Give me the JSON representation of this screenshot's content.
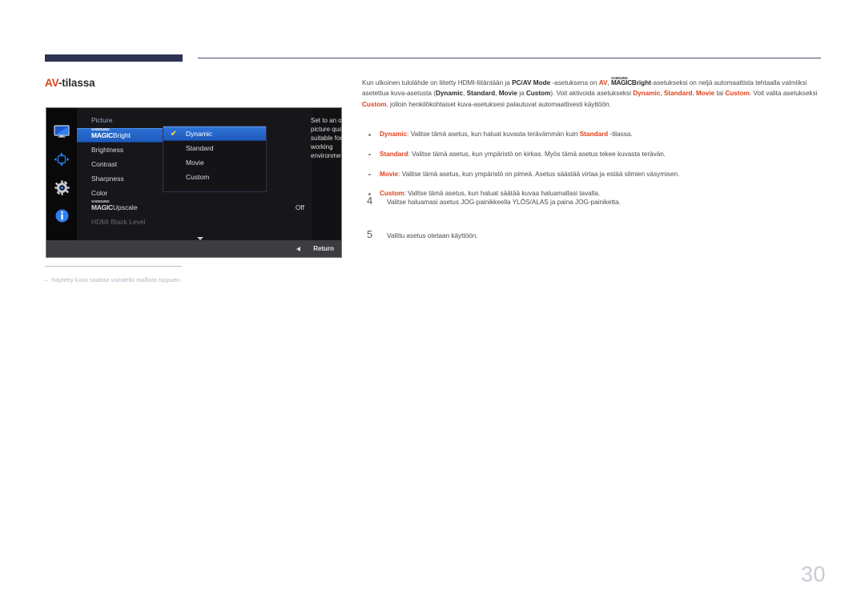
{
  "heading": {
    "accent": "AV",
    "rest": "-tilassa"
  },
  "osd": {
    "title": "Picture",
    "rail_icons": [
      "monitor-icon",
      "joystick-icon",
      "gear-icon",
      "info-icon"
    ],
    "menu_items": [
      {
        "label_small": "SAMSUNG",
        "label_main": "MAGIC",
        "label_tail": "Bright",
        "value": "",
        "selected": true,
        "dim": false
      },
      {
        "label_main": "",
        "label_tail": "Brightness",
        "value": "",
        "selected": false,
        "dim": false
      },
      {
        "label_main": "",
        "label_tail": "Contrast",
        "value": "",
        "selected": false,
        "dim": false
      },
      {
        "label_main": "",
        "label_tail": "Sharpness",
        "value": "",
        "selected": false,
        "dim": false
      },
      {
        "label_main": "",
        "label_tail": "Color",
        "value": "",
        "selected": false,
        "dim": false
      },
      {
        "label_small": "SAMSUNG",
        "label_main": "MAGIC",
        "label_tail": "Upscale",
        "value": "Off",
        "selected": false,
        "dim": false
      },
      {
        "label_main": "",
        "label_tail": "HDMI Black Level",
        "value": "",
        "selected": false,
        "dim": true
      }
    ],
    "submenu": [
      {
        "label": "Dynamic",
        "checked": true,
        "selected": true
      },
      {
        "label": "Standard",
        "checked": false,
        "selected": false
      },
      {
        "label": "Movie",
        "checked": false,
        "selected": false
      },
      {
        "label": "Custom",
        "checked": false,
        "selected": false
      }
    ],
    "help_text": "Set to an optimum picture quality suitable for the working environment.",
    "return_label": "Return"
  },
  "footnote": {
    "dash": "‒",
    "text": "Näytetty kuva saattaa vaihdella mallista riippuen."
  },
  "intro": {
    "p1_a": "Kun ulkoinen tulolähde on liitetty HDMI-liitäntään ja ",
    "pcav": "PC/AV Mode",
    "p1_b": " -asetuksena on ",
    "av": "AV",
    "p1_c": ", ",
    "magic_small": "SAMSUNG",
    "magic_main": "MAGIC",
    "magic_tail": "Bright",
    "p1_d": "-asetukseksi on neljä automaattista tehtaalla valmiiksi asetettua kuva-asetusta (",
    "o1": "Dynamic",
    "sep1": ", ",
    "o2": "Standard",
    "sep2": ", ",
    "o3": "Movie",
    "sep3": " ja ",
    "o4": "Custom",
    "p1_e": "). Voit aktivoida asetukseksi ",
    "o5": "Dynamic",
    "sep5": ", ",
    "o6": "Standard",
    "sep6": ", ",
    "o7": "Movie",
    "sep7": " tai ",
    "o8": "Custom",
    "p1_f": ". Voit valita asetukseksi ",
    "o9": "Custom",
    "p1_g": ", jolloin henkilökohtaiset kuva-asetuksesi palautuvat automaattisesti käyttöön."
  },
  "bullets": [
    {
      "term": "Dynamic",
      "text_a": ": Valitse tämä asetus, kun haluat kuvasta terävämmän kuin ",
      "term2": "Standard",
      "text_b": " -tilassa."
    },
    {
      "term": "Standard",
      "text_a": ": Valitse tämä asetus, kun ympäristö on kirkas. Myös tämä asetus tekee kuvasta terävän.",
      "term2": "",
      "text_b": ""
    },
    {
      "term": "Movie",
      "text_a": ": Valitse tämä asetus, kun ympäristö on pimeä. Asetus säästää virtaa ja estää silmien väsymisen.",
      "term2": "",
      "text_b": ""
    },
    {
      "term": "Custom",
      "text_a": ": Valitse tämä asetus, kun haluat säätää kuvaa haluamallasi tavalla.",
      "term2": "",
      "text_b": ""
    }
  ],
  "steps": [
    {
      "num": "4",
      "text": "Valitse haluamasi asetus JOG-painikkeella YLÖS/ALAS ja paina JOG-painiketta."
    },
    {
      "num": "5",
      "text": "Valittu asetus otetaan käyttöön."
    }
  ],
  "page_number": "30",
  "colors": {
    "accent": "#e0401b",
    "rule": "#2e3353",
    "osd_highlight": "#2b6fd4",
    "check": "#ffd447"
  }
}
